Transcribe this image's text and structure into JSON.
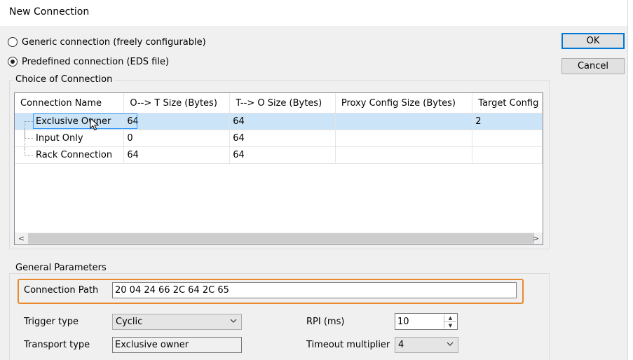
{
  "window": {
    "title": "New Connection"
  },
  "options": {
    "generic_label": "Generic connection (freely configurable)",
    "predefined_label": "Predefined connection (EDS file)",
    "selected": "predefined"
  },
  "buttons": {
    "ok": "OK",
    "cancel": "Cancel"
  },
  "choice_group": {
    "label": "Choice of Connection",
    "columns": [
      "Connection Name",
      "O--> T Size (Bytes)",
      "T--> O Size (Bytes)",
      "Proxy Config Size (Bytes)",
      "Target Config"
    ],
    "rows": [
      {
        "name": "Exclusive Owner",
        "ot": "64",
        "to": "64",
        "proxy": "",
        "target": "2",
        "selected": true
      },
      {
        "name": "Input Only",
        "ot": "0",
        "to": "64",
        "proxy": "",
        "target": "",
        "selected": false
      },
      {
        "name": "Rack Connection",
        "ot": "64",
        "to": "64",
        "proxy": "",
        "target": "",
        "selected": false
      }
    ],
    "scroll_left": "<",
    "scroll_right": ">"
  },
  "params": {
    "label": "General Parameters",
    "connection_path_label": "Connection Path",
    "connection_path": "20 04 24 66 2C 64 2C 65",
    "trigger_type_label": "Trigger type",
    "trigger_type": "Cyclic",
    "transport_type_label": "Transport type",
    "transport_type": "Exclusive owner",
    "rpi_label": "RPI (ms)",
    "rpi": "10",
    "timeout_label": "Timeout multiplier",
    "timeout": "4"
  },
  "icons": {
    "dropdown": "chevron-down-icon",
    "cursor": "mouse-pointer-icon"
  },
  "colors": {
    "selection": "#cce4f7",
    "highlight_border": "#e8892d",
    "default_button_border": "#0078d7"
  }
}
